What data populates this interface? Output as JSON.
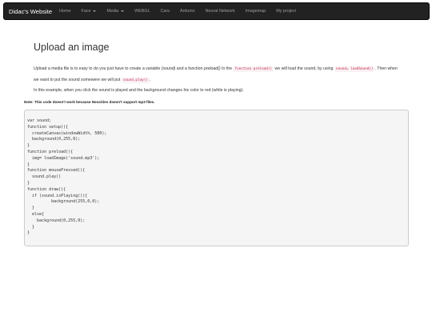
{
  "navbar": {
    "brand": "Didac's Website",
    "items": [
      {
        "label": "Home",
        "dropdown": false
      },
      {
        "label": "Face",
        "dropdown": true
      },
      {
        "label": "Media",
        "dropdown": true
      },
      {
        "label": "WEBGL",
        "dropdown": false
      },
      {
        "label": "Cars",
        "dropdown": false
      },
      {
        "label": "Arduino",
        "dropdown": false
      },
      {
        "label": "Neural Network",
        "dropdown": false
      },
      {
        "label": "Imagemap",
        "dropdown": false
      },
      {
        "label": "My project",
        "dropdown": false
      }
    ]
  },
  "page": {
    "title": "Upload an image",
    "para1": {
      "t1": "Upload a media file is to easy to do you just have to create a variable ",
      "em1": "(sound)",
      "t2": " and a function ",
      "em2": "preload()",
      "t3": " In the ",
      "code1": "function preload()",
      "t4": " we will load the sound, by using ",
      "code2": "sound= loadSound()",
      "t5": ". Then when we want to put the sound somewere we will put ",
      "code3": "sound.play()",
      "t6": "."
    },
    "para2": "In this example, when you click the sound is played and the background changes his color to red (while is playing).",
    "note": "Note: This code doesn't work because Neocities doesn't support mp3 files.",
    "code": "var sound;\nfunction setup(){\n  createCanvas(windowWidth, 500);\n  background(0,255,0);\n}\nfunction preload(){\n  img= loadImage('sound.mp3');\n}\nfunction mousePressed(){\n  sound.play()\n}\nfunction draw(){\n  if (sound.isPlaying()){\n          background(255,0,0);\n  }\n  else{\n    background(0,255,0);\n  }\n}"
  },
  "colors": {
    "navbar_bg": "#222222",
    "navbar_link": "#9d9d9d",
    "code_inline_fg": "#c7254e",
    "code_inline_bg": "#f9f2f4",
    "code_block_bg": "#f5f5f5"
  }
}
